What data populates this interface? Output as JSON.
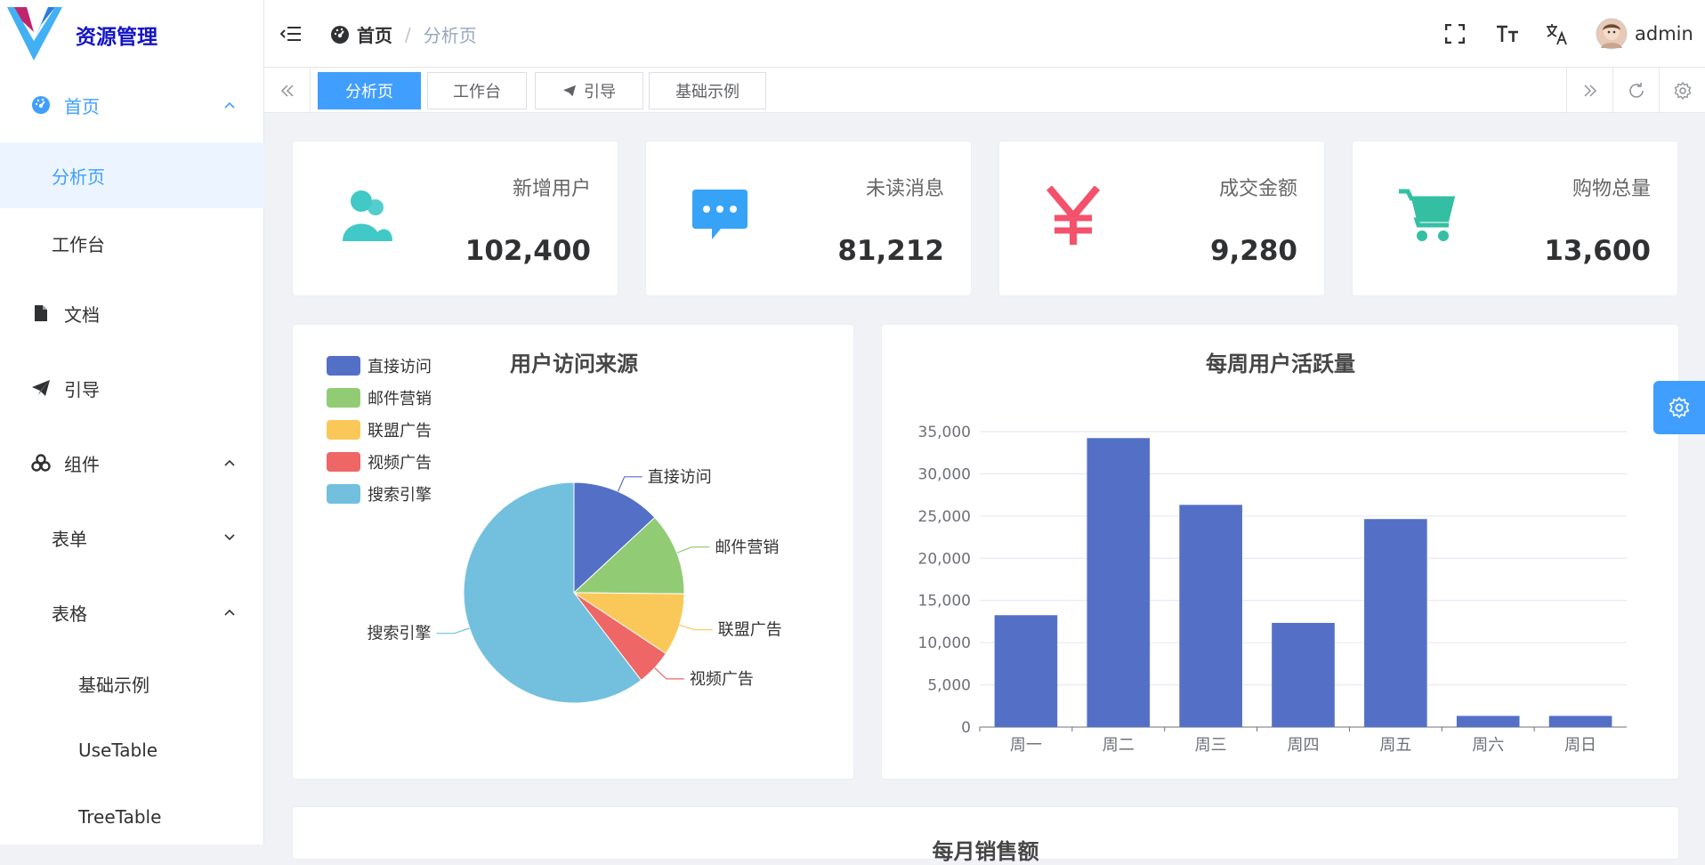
{
  "app": {
    "title": "资源管理"
  },
  "sidebar": {
    "items": [
      {
        "label": "首页",
        "icon": "dashboard-icon"
      },
      {
        "label": "分析页"
      },
      {
        "label": "工作台"
      },
      {
        "label": "文档",
        "icon": "document-icon"
      },
      {
        "label": "引导",
        "icon": "paper-plane-icon"
      },
      {
        "label": "组件",
        "icon": "components-icon"
      },
      {
        "label": "表单"
      },
      {
        "label": "表格"
      },
      {
        "label": "基础示例"
      },
      {
        "label": "UseTable"
      },
      {
        "label": "TreeTable"
      }
    ]
  },
  "header": {
    "breadcrumb": [
      {
        "label": "首页"
      },
      {
        "label": "分析页"
      }
    ],
    "separator": "/",
    "user": "admin"
  },
  "tabs": [
    {
      "label": "分析页",
      "active": true
    },
    {
      "label": "工作台"
    },
    {
      "label": "引导"
    },
    {
      "label": "基础示例"
    }
  ],
  "stats": [
    {
      "title": "新增用户",
      "value": "102,400",
      "icon": "users-icon",
      "color": "#40c9c6"
    },
    {
      "title": "未读消息",
      "value": "81,212",
      "icon": "message-icon",
      "color": "#36a3f7"
    },
    {
      "title": "成交金额",
      "value": "9,280",
      "icon": "yen-icon",
      "color": "#f4516c"
    },
    {
      "title": "购物总量",
      "value": "13,600",
      "icon": "cart-icon",
      "color": "#34bfa3"
    }
  ],
  "colors": {
    "primary": "#409eff",
    "bar": "#5470c6"
  },
  "chart_data": [
    {
      "type": "pie",
      "title": "用户访问来源",
      "legend_position": "top-left",
      "categories": [
        "直接访问",
        "邮件营销",
        "联盟广告",
        "视频广告",
        "搜索引擎"
      ],
      "values": [
        335,
        310,
        234,
        135,
        1548
      ],
      "colors": [
        "#5470c6",
        "#91cc75",
        "#fac858",
        "#ee6666",
        "#73c0de"
      ]
    },
    {
      "type": "bar",
      "title": "每周用户活跃量",
      "categories": [
        "周一",
        "周二",
        "周三",
        "周四",
        "周五",
        "周六",
        "周日"
      ],
      "values": [
        13253,
        34235,
        26321,
        12340,
        24643,
        1322,
        1324
      ],
      "ylim": [
        0,
        35000
      ],
      "yticks": [
        "0",
        "5,000",
        "10,000",
        "15,000",
        "20,000",
        "25,000",
        "30,000",
        "35,000"
      ],
      "grid": true
    }
  ],
  "bottom_card": {
    "title": "每月销售额"
  }
}
